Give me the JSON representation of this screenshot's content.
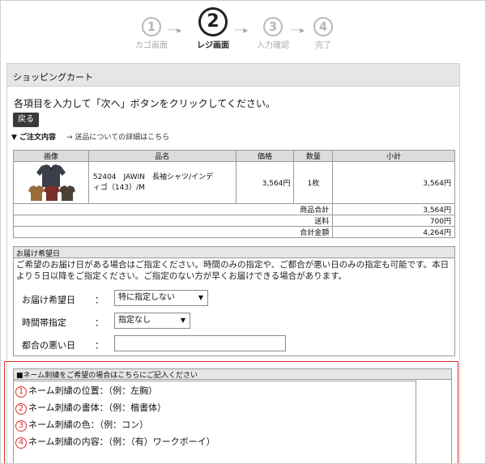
{
  "steps": [
    {
      "num": "1",
      "label": "カゴ画面"
    },
    {
      "num": "2",
      "label": "レジ画面"
    },
    {
      "num": "3",
      "label": "入力確認"
    },
    {
      "num": "4",
      "label": "完了"
    }
  ],
  "step_arrow": "····▸",
  "panel": {
    "title": "ショッピングカート"
  },
  "instruction": "各項目を入力して「次へ」ボタンをクリックしてください。",
  "back_button": "戻る",
  "order": {
    "heading": "▼ ご注文内容",
    "shipping_link": "→ 送品についての詳細はこちら"
  },
  "cart": {
    "headers": [
      "画像",
      "品名",
      "価格",
      "数量",
      "小計"
    ],
    "item": {
      "name_line1": "52404　JAWIN　長袖シャツ/インデ",
      "name_line2": "ィゴ（143）/M",
      "price": "3,564円",
      "qty": "1枚",
      "subtotal": "3,564円"
    },
    "summary": [
      {
        "label": "商品合計",
        "value": "3,564円"
      },
      {
        "label": "送料",
        "value": "700円"
      },
      {
        "label": "合計金額",
        "value": "4,264円"
      }
    ]
  },
  "delivery": {
    "title": "お届け希望日",
    "note": "ご希望のお届け日がある場合はご指定ください。時間のみの指定や、ご都合が悪い日のみの指定も可能です。本日より５日以降をご指定ください。ご指定のない方が早くお届けできる場合があります。",
    "date_label": "お届け希望日",
    "date_value": "特に指定しない",
    "time_label": "時間帯指定",
    "time_value": "指定なし",
    "ng_label": "都合の悪い日",
    "ng_value": "",
    "colon": "：",
    "caret": "▼"
  },
  "embroidery": {
    "title": "■ネーム刺繍をご希望の場合はこちらにご記入ください",
    "lines": [
      {
        "num": "1",
        "text": "ネーム刺繍の位置：（例：左胸）"
      },
      {
        "num": "2",
        "text": "ネーム刺繍の書体：（例：楷書体）"
      },
      {
        "num": "3",
        "text": "ネーム刺繍の色：（例：コン）"
      },
      {
        "num": "4",
        "text": "ネーム刺繍の内容：（例：（有）ワークボーイ）"
      }
    ]
  },
  "colors": {
    "accent_red": "#e03030",
    "header_gray": "#e6e6e6",
    "button_dark": "#3a3a3a"
  }
}
